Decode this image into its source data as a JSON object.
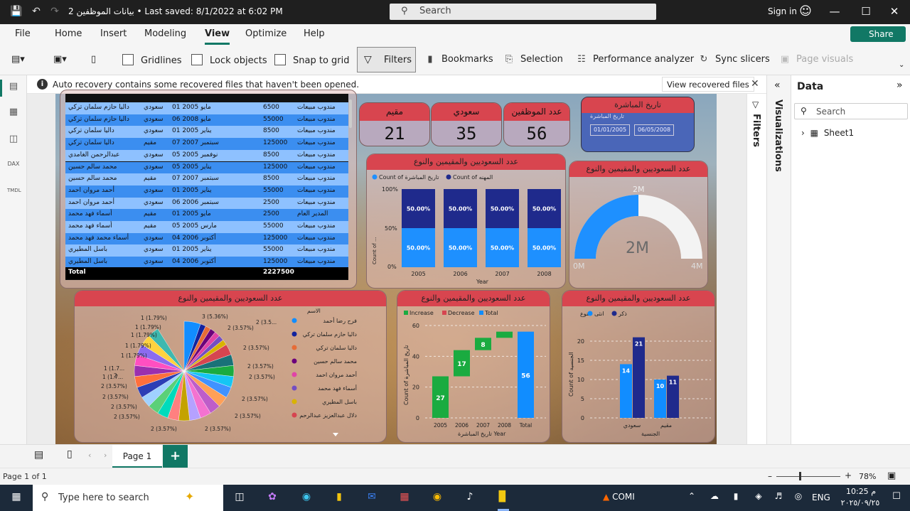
{
  "titlebar": {
    "title": "بيانات الموظفين 2  •  Last saved: 8/1/2022 at 6:02 PM",
    "search": "Search",
    "signin": "Sign in"
  },
  "menu": [
    "File",
    "Home",
    "Insert",
    "Modeling",
    "View",
    "Optimize",
    "Help"
  ],
  "share": "Share",
  "ribbon": {
    "gridlines": "Gridlines",
    "lock": "Lock objects",
    "snap": "Snap to grid",
    "filters": "Filters",
    "bookmarks": "Bookmarks",
    "selection": "Selection",
    "perf": "Performance analyzer",
    "sync": "Sync slicers",
    "pagevisuals": "Page visuals"
  },
  "infobar": {
    "text": "Auto recovery contains some recovered files that haven't been opened.",
    "button": "View recovered files"
  },
  "table": {
    "rows": [
      [
        "داليا حازم سلمان تركي",
        "سعودي",
        "مايو 2005 01",
        "6500",
        "مندوب مبيعات"
      ],
      [
        "داليا حازم سلمان تركي",
        "سعودي",
        "مايو 2008 06",
        "55000",
        "مندوب مبيعات"
      ],
      [
        "داليا سلمان تركي",
        "سعودي",
        "يناير 2005 01",
        "8500",
        "مندوب مبيعات"
      ],
      [
        "داليا سلمان تركي",
        "مقيم",
        "سبتمبر 2007 07",
        "125000",
        "مندوب مبيعات"
      ],
      [
        "عبدالرحمن الغامدي",
        "سعودي",
        "نوفمبر 2005 05",
        "8500",
        "مندوب مبيعات"
      ],
      [
        "محمد سالم حسين",
        "سعودي",
        "يناير 2005 05",
        "125000",
        "مندوب مبيعات"
      ],
      [
        "محمد سالم حسين",
        "مقيم",
        "سبتمبر 2007 07",
        "8500",
        "مندوب مبيعات"
      ],
      [
        "أحمد مروان احمد",
        "سعودي",
        "يناير 2005 01",
        "55000",
        "مندوب مبيعات"
      ],
      [
        "أحمد مروان احمد",
        "سعودي",
        "سبتمبر 2006 06",
        "2500",
        "مندوب مبيعات"
      ],
      [
        "أسماء فهد محمد",
        "مقيم",
        "مايو 2005 01",
        "2500",
        "المدير العام"
      ],
      [
        "أسماء فهد محمد",
        "مقيم",
        "مارس 2005 05",
        "55000",
        "مندوب مبيعات"
      ],
      [
        "أسماء محمد فهد محمد",
        "سعودي",
        "أكتوبر 2006 04",
        "125000",
        "مندوب مبيعات"
      ],
      [
        "باسل المطيري",
        "سعودي",
        "يناير 2005 01",
        "55000",
        "مندوب مبيعات"
      ],
      [
        "باسل المطيري",
        "سعودي",
        "أكتوبر 2006 04",
        "125000",
        "مندوب مبيعات"
      ]
    ],
    "total_label": "Total",
    "total_value": "2227500"
  },
  "kpis": [
    {
      "label": "مقيم",
      "value": "21"
    },
    {
      "label": "سعودي",
      "value": "35"
    },
    {
      "label": "عدد الموظفين",
      "value": "56"
    }
  ],
  "dateslicer": {
    "title": "تاريخ المباشرة",
    "sub": "تاريخ المباشرة",
    "from": "01/01/2005",
    "to": "06/05/2008"
  },
  "stacked": {
    "title": "عدد السعوديين والمقيمين والنوع",
    "legend": [
      "Count of تاريخ المباشرة",
      "Count of المهنه"
    ],
    "ylabel": "Count of ...",
    "xlabel": "Year",
    "yticks": [
      "100%",
      "50%",
      "0%"
    ]
  },
  "gauge": {
    "title": "عدد السعوديين والمقيمين والنوع",
    "top": "2M",
    "center": "2M",
    "min": "0M",
    "max": "4M"
  },
  "pie": {
    "title": "عدد السعوديين والمقيمين والنوع",
    "legend_title": "الاسم",
    "legend": [
      "فرح رضا أحمد",
      "داليا حازم سلمان تركي",
      "داليا سلمان تركي",
      "محمد سالم حسين",
      "أحمد مروان احمد",
      "أسماء فهد محمد",
      "باسل المطيري",
      "دلال عبدالعزيز عبدالرحم"
    ]
  },
  "waterfall": {
    "title": "عدد السعوديين والمقيمين والنوع",
    "legend": [
      "Increase",
      "Decrease",
      "Total"
    ],
    "ylabel": "Count of تاريخ المباشرة",
    "xlabel": "تاريخ المباشرة Year"
  },
  "clustered": {
    "title": "عدد السعوديين والمقيمين والنوع",
    "legend_title": "النوع",
    "legend": [
      "انثى",
      "ذكر"
    ],
    "ylabel": "Count of الجنسية",
    "xlabel": "الجنسية"
  },
  "panes": {
    "filters": "Filters",
    "visualizations": "Visualizations",
    "data": "Data",
    "search": "Search",
    "sheet": "Sheet1"
  },
  "pagebar": {
    "page": "Page 1"
  },
  "status": {
    "left": "Page 1 of 1",
    "zoom": "78%"
  },
  "taskbar": {
    "search": "Type here to search",
    "app": "COMI",
    "lang": "ENG",
    "time": "10:25 م",
    "date": "٢٠٢٥/٠٩/٢٥"
  },
  "chart_data": [
    {
      "type": "bar",
      "title": "عدد السعوديين والمقيمين والنوع",
      "categories": [
        "2005",
        "2006",
        "2007",
        "2008"
      ],
      "ylabel": "Count of ...",
      "xlabel": "Year",
      "series": [
        {
          "name": "Count of تاريخ المباشرة",
          "values": [
            50,
            50,
            50,
            50
          ]
        },
        {
          "name": "Count of المهنه",
          "values": [
            50,
            50,
            50,
            50
          ]
        }
      ],
      "ylim": [
        0,
        100
      ],
      "stacked": "100%"
    },
    {
      "type": "bar",
      "title": "عدد السعوديين والمقيمين والنوع",
      "subtype": "waterfall",
      "categories": [
        "2005",
        "2006",
        "2007",
        "2008",
        "Total"
      ],
      "values": [
        27,
        17,
        8,
        4,
        56
      ],
      "ylim": [
        0,
        60
      ],
      "yticks": [
        0,
        20,
        40,
        60
      ]
    },
    {
      "type": "bar",
      "title": "عدد السعوديين والمقيمين والنوع",
      "categories": [
        "سعودي",
        "مقيم"
      ],
      "series": [
        {
          "name": "انثى",
          "values": [
            14,
            10
          ]
        },
        {
          "name": "ذكر",
          "values": [
            21,
            11
          ]
        }
      ],
      "ylim": [
        0,
        20
      ],
      "yticks": [
        0,
        5,
        10,
        15,
        20
      ]
    },
    {
      "type": "pie",
      "title": "عدد السعوديين والمقيمين والنوع",
      "slices": 28,
      "labels": [
        "1 (1.79%)",
        "1 (1.79%)",
        "1 (1.79%)",
        "1 (1.79%)",
        "1 (1.79%)",
        "1 (1.7...",
        "1 (1.7...",
        "2",
        "2 (3.57%)",
        "2 (3.57%)",
        "2 (3.57%)",
        "2 (3.57%)",
        "2 (3.57%)",
        "2 (3.57%)",
        "2 (3.5...",
        "3 (5.36%)",
        "2 (3.57%)",
        "2 (3.57%)",
        "2 (3.57%)",
        "2 (3.57%)",
        "2 (3.57%)",
        "2 (3.57%)"
      ]
    }
  ]
}
